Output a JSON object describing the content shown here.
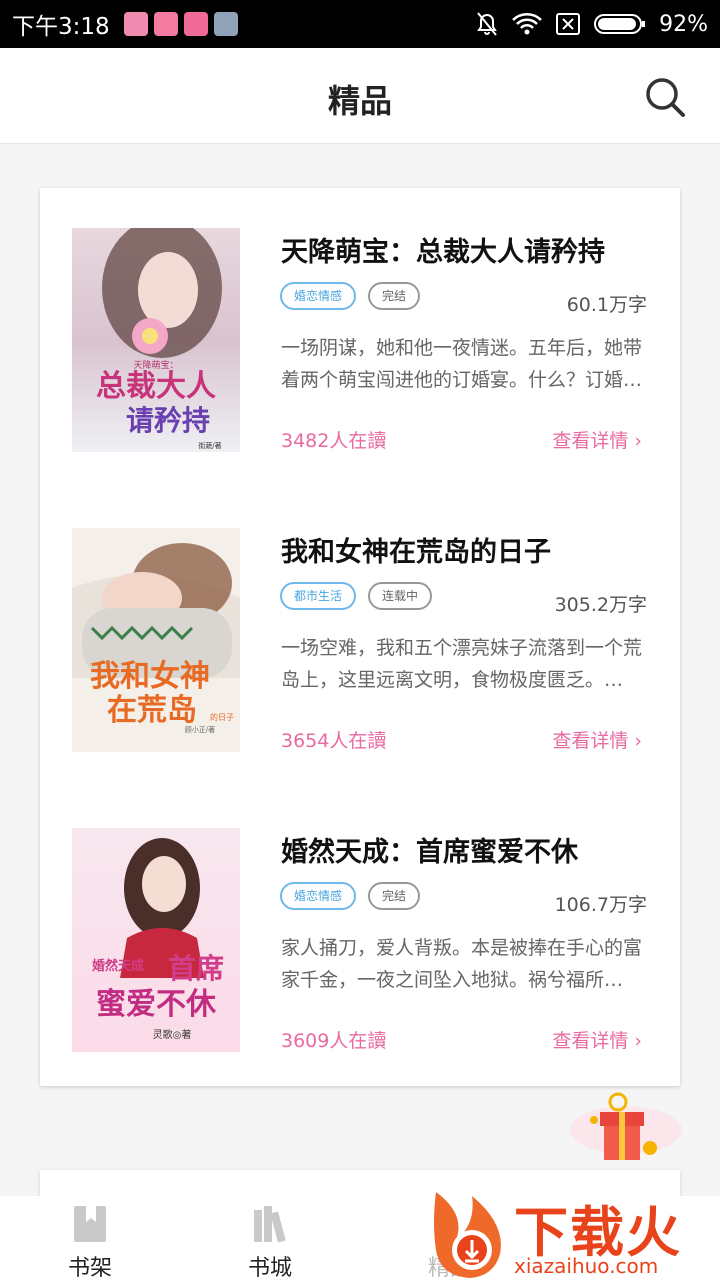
{
  "status_bar": {
    "time": "下午3:18",
    "battery": "92%"
  },
  "header": {
    "title": "精品"
  },
  "books": [
    {
      "title": "天降萌宝：总裁大人请矜持",
      "genre": "婚恋情感",
      "status": "完结",
      "word_count": "60.1万字",
      "description": "一场阴谋，她和他一夜情迷。五年后，她带着两个萌宝闯进他的订婚宴。什么？订婚…",
      "readers": "3482人在讀",
      "detail": "查看详情",
      "cover": {
        "small_title": "天降萌宝：",
        "main_title_1": "总裁大人",
        "main_title_2": "请矜持",
        "author": "街蔬/著"
      }
    },
    {
      "title": "我和女神在荒岛的日子",
      "genre": "都市生活",
      "status": "连载中",
      "word_count": "305.2万字",
      "description": "一场空难，我和五个漂亮妹子流落到一个荒岛上，这里远离文明，食物极度匮乏。…",
      "readers": "3654人在讀",
      "detail": "查看详情",
      "cover": {
        "main_title_1": "我和女神",
        "main_title_2": "在荒岛",
        "small_title": "的日子",
        "author": "顾小正/著"
      }
    },
    {
      "title": "婚然天成：首席蜜爱不休",
      "genre": "婚恋情感",
      "status": "完结",
      "word_count": "106.7万字",
      "description": "家人捅刀，爱人背叛。本是被捧在手心的富家千金，一夜之间坠入地狱。祸兮福所…",
      "readers": "3609人在讀",
      "detail": "查看详情",
      "cover": {
        "small_title": "婚然天成",
        "main_title_1": "首席",
        "main_title_2": "蜜爱不休",
        "author": "灵歌◎著"
      }
    }
  ],
  "bottom_nav": [
    {
      "label": "书架"
    },
    {
      "label": "书城"
    },
    {
      "label": "精品"
    }
  ],
  "watermark": {
    "text": "下载火",
    "domain": "xiazaihuo.com"
  },
  "colors": {
    "accent_pink": "#e96aa0",
    "tag_blue": "#4aa6e0",
    "watermark_orange": "#e8431a"
  }
}
